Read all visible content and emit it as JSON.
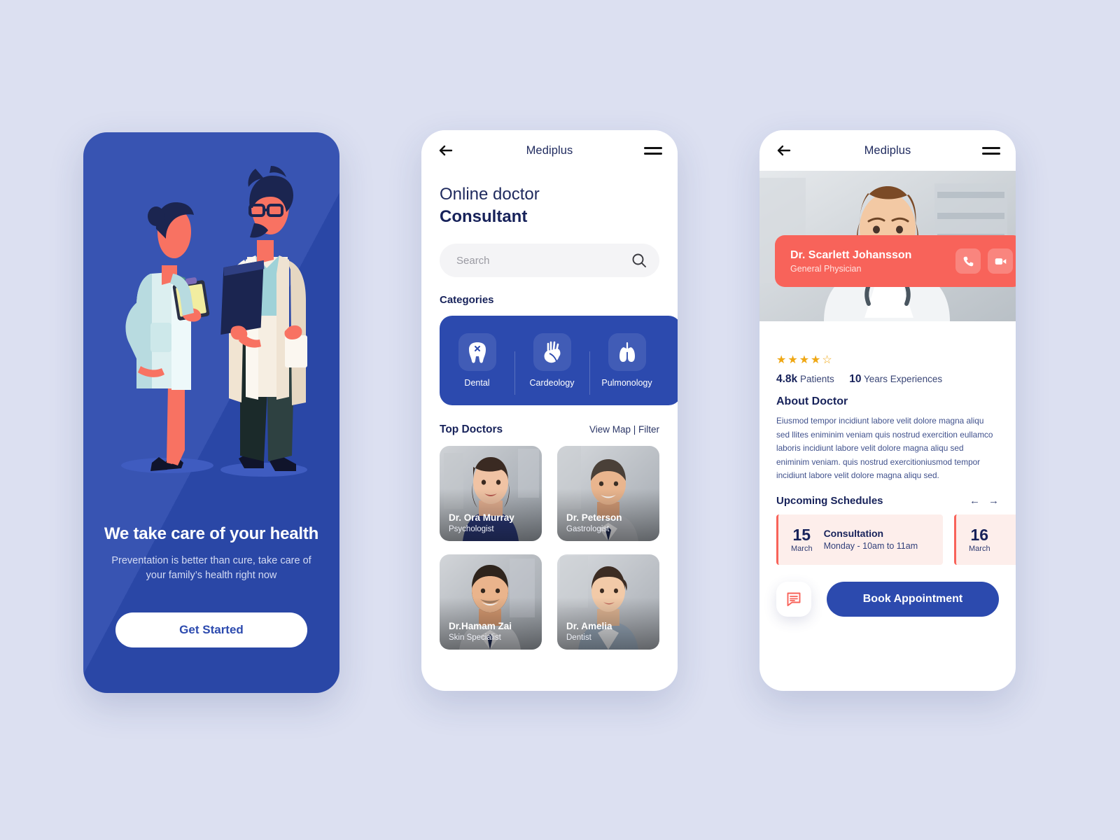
{
  "app": {
    "name": "Mediplus"
  },
  "onboarding": {
    "headline": "We take care of your health",
    "subtext": "Preventation is better than cure, take care of your family’s health right now",
    "cta": "Get Started",
    "bg_color": "#2c4aae"
  },
  "list_screen": {
    "topbar": {
      "title": "Mediplus",
      "back_icon": "arrow-left-icon",
      "menu_icon": "hamburger-icon"
    },
    "heading_line1": "Online doctor",
    "heading_line2": "Consultant",
    "search": {
      "placeholder": "Search",
      "value": "",
      "icon": "search-icon"
    },
    "categories_title": "Categories",
    "categories": [
      {
        "label": "Dental",
        "icon": "tooth-icon"
      },
      {
        "label": "Cardeology",
        "icon": "heart-organ-icon"
      },
      {
        "label": "Pulmonology",
        "icon": "lungs-icon"
      }
    ],
    "top_doctors_title": "Top Doctors",
    "top_doctors_actions": "View Map | Filter",
    "doctors": [
      {
        "name": "Dr. Ora Murray",
        "role": "Psychologist"
      },
      {
        "name": "Dr. Peterson",
        "role": "Gastrologist"
      },
      {
        "name": "Dr.Hamam Zai",
        "role": "Skin Specialist"
      },
      {
        "name": "Dr. Amelia",
        "role": "Dentist"
      }
    ]
  },
  "detail_screen": {
    "topbar": {
      "title": "Mediplus",
      "back_icon": "arrow-left-icon",
      "menu_icon": "hamburger-icon"
    },
    "doctor": {
      "name": "Dr. Scarlett Johansson",
      "role": "General Physician",
      "card_color": "#f8635a",
      "call_icon": "phone-icon",
      "video_icon": "video-camera-icon"
    },
    "rating": {
      "filled": 4,
      "total": 5,
      "color": "#efa713"
    },
    "stats": {
      "patients_value": "4.8k",
      "patients_label": "Patients",
      "years_value": "10",
      "years_label": "Years Experiences"
    },
    "about_title": "About Doctor",
    "about_text": "Eiusmod tempor incidiunt labore velit dolore magna aliqu sed llites eniminim veniam quis nostrud exercition eullamco laboris incidiunt labore velit dolore magna aliqu sed eniminim veniam. quis nostrud exercitioniusmod tempor incidiunt labore velit dolore magna aliqu sed.",
    "schedules_title": "Upcoming Schedules",
    "schedules_prev": "←",
    "schedules_next": "→",
    "schedules": [
      {
        "day": "15",
        "month": "March",
        "event": "Consultation",
        "time": "Monday - 10am to 11am"
      },
      {
        "day": "16",
        "month": "March",
        "event": "",
        "time": ""
      }
    ],
    "chat_icon": "chat-bubble-icon",
    "book_label": "Book Appointment"
  }
}
